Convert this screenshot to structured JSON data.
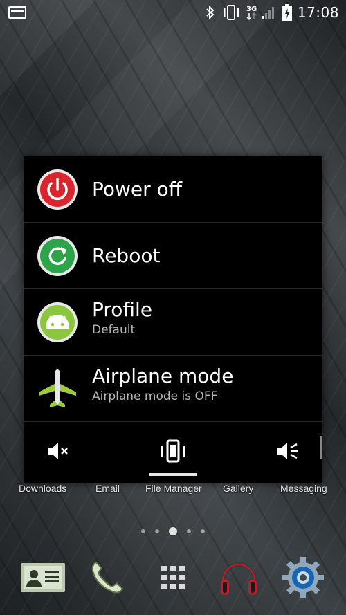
{
  "status_bar": {
    "time": "17:08",
    "network": "3G",
    "icons": [
      "notification-icon",
      "bluetooth-icon",
      "vibrate-icon",
      "signal-icon",
      "battery-charging-icon"
    ]
  },
  "power_menu": {
    "items": [
      {
        "title": "Power off",
        "subtitle": "",
        "icon": "power-icon",
        "color": "#d9262e"
      },
      {
        "title": "Reboot",
        "subtitle": "",
        "icon": "reboot-icon",
        "color": "#2ea44a"
      },
      {
        "title": "Profile",
        "subtitle": "Default",
        "icon": "android-icon",
        "color": "#8cc63f"
      },
      {
        "title": "Airplane mode",
        "subtitle": "Airplane mode is OFF",
        "icon": "airplane-icon",
        "color": "#9ccc3a"
      }
    ],
    "sound_modes": {
      "options": [
        "mute-icon",
        "vibrate-icon",
        "sound-on-icon"
      ],
      "selected": "vibrate-icon"
    }
  },
  "home_screen": {
    "app_labels": [
      "Downloads",
      "Email",
      "File Manager",
      "Gallery",
      "Messaging"
    ],
    "page_count": 5,
    "active_page": 3,
    "dock": [
      "contacts-icon",
      "phone-icon",
      "app-drawer-icon",
      "music-headphones-icon",
      "settings-gear-icon"
    ]
  }
}
